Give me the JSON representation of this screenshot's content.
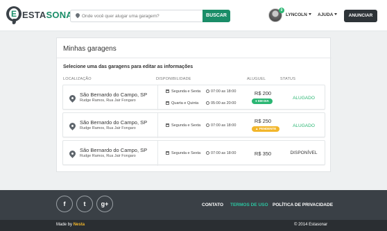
{
  "header": {
    "logo_part1": "ESTA",
    "logo_part2": "SONAR",
    "logo_letter": "E",
    "search_placeholder": "Onde você quer alugar uma garagem?",
    "search_button": "BUSCAR",
    "notification_count": "0",
    "user_name": "LYNCOLN",
    "help_label": "AJUDA",
    "announce_button": "ANUNCIAR"
  },
  "main": {
    "title": "Minhas garagens",
    "subtitle": "Selecione uma das garagens para editar as informações",
    "columns": [
      "LOCALIZAÇÃO",
      "DISPONIBILIDADE",
      "ALUGUEL",
      "STATUS"
    ],
    "rows": [
      {
        "city": "São Bernardo do Campo, SP",
        "street": "Rudge Ramos, Rua Jair Fongaro",
        "schedule": [
          {
            "days": "Segunda e Sexta",
            "hours": "07:00 as 18:00"
          },
          {
            "days": "Quarta e Quinta",
            "hours": "05:00 as 20:00"
          }
        ],
        "price": "R$ 200",
        "badge": "EM DIA",
        "badge_color": "#2bb673",
        "status": "ALUGADO"
      },
      {
        "city": "São Bernardo do Campo, SP",
        "street": "Rudge Ramos, Rua Jair Fongaro",
        "schedule": [
          {
            "days": "Segunda e Sexta",
            "hours": "07:00 as 18:00"
          }
        ],
        "price": "R$ 250",
        "badge": "PENDENTE",
        "badge_color": "#f2b62b",
        "status": "ALUGADO"
      },
      {
        "city": "São Bernardo do Campo, SP",
        "street": "Rudge Ramos, Rua Jair Fongaro",
        "schedule": [
          {
            "days": "Segunda e Sexta",
            "hours": "07:00 as 18:00"
          }
        ],
        "price": "R$ 350",
        "status": "DISPONÍVEL"
      }
    ]
  },
  "footer": {
    "social": [
      "f",
      "t",
      "g+"
    ],
    "links": [
      "CONTATO",
      "TERMOS DE USO",
      "POLÍTICA DE PRIVACIDADE"
    ],
    "made_by_prefix": "Made by",
    "made_by_name": "Nesta",
    "copyright": "© 2014 Estasonar"
  },
  "colors": {
    "brand_green": "#1a8d68",
    "status_green": "#2bb673",
    "accent_teal": "#2bc4a0",
    "pending_yellow": "#f2b62b",
    "footer_dark": "#3a4046"
  }
}
